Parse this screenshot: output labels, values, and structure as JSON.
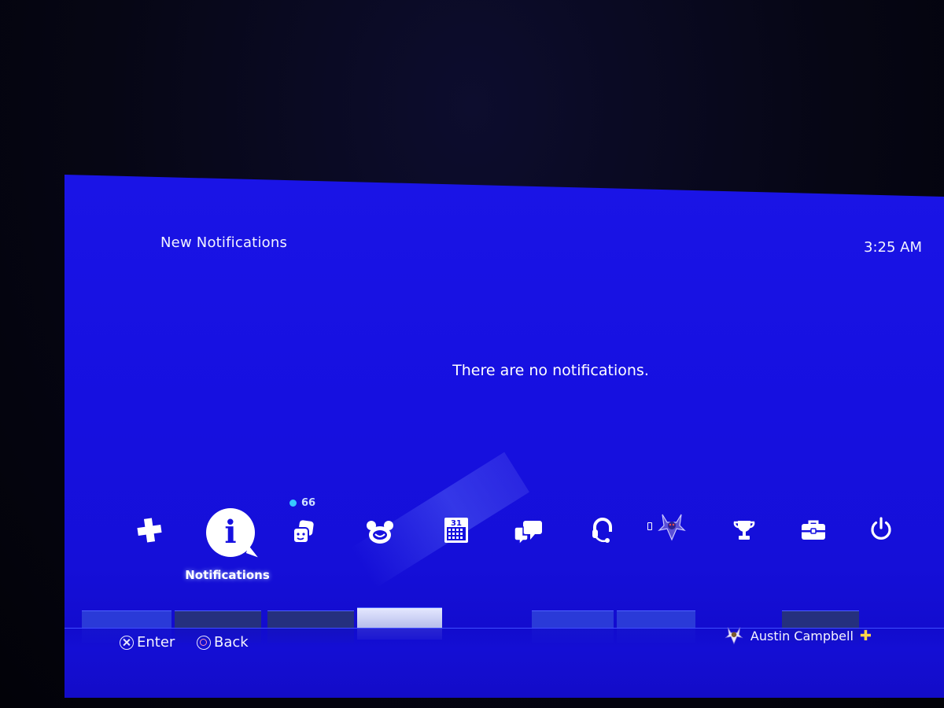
{
  "header": {
    "title": "New Notifications",
    "clock": "3:25 AM"
  },
  "main": {
    "empty_message": "There are no notifications."
  },
  "function_bar": {
    "selected_label": "Notifications",
    "friends_badge": "66",
    "calendar_day": "31"
  },
  "footer": {
    "enter_label": "Enter",
    "back_label": "Back",
    "user_name": "Austin Campbell"
  },
  "colors": {
    "background": "#1610e0",
    "text": "#ffffff",
    "badge_dot": "#37c8ff",
    "plus": "#ffd54a"
  }
}
